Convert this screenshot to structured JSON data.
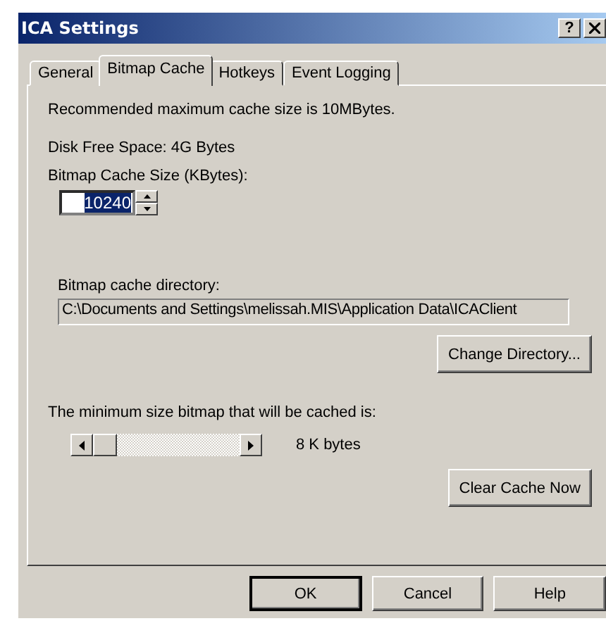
{
  "window": {
    "title": "ICA Settings",
    "help_button": "?"
  },
  "tabs": [
    {
      "label": "General",
      "selected": false
    },
    {
      "label": "Bitmap Cache",
      "selected": true
    },
    {
      "label": "Hotkeys",
      "selected": false
    },
    {
      "label": "Event Logging",
      "selected": false
    }
  ],
  "recommendation": "Recommended maximum cache size is 10MBytes.",
  "disk_free_space": "Disk Free Space: 4G Bytes",
  "cache_size": {
    "label": "Bitmap Cache Size (KBytes):",
    "value": "10240"
  },
  "directory": {
    "label": "Bitmap cache directory:",
    "value": "C:\\Documents and Settings\\melissah.MIS\\Application Data\\ICAClient",
    "button": "Change Directory..."
  },
  "minimum_size": {
    "label": "The minimum size bitmap that will be cached is:",
    "level": 0,
    "reading": "8  K bytes"
  },
  "clear_button": "Clear Cache Now",
  "buttons": [
    "OK",
    "Cancel",
    "Help"
  ]
}
